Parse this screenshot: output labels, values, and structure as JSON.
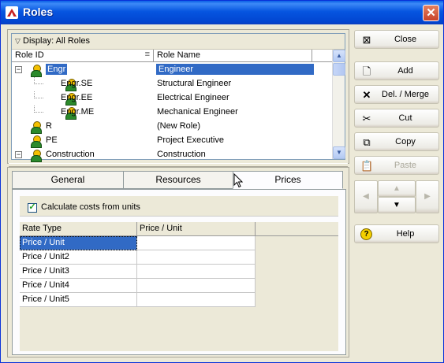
{
  "window": {
    "title": "Roles",
    "close_glyph": "✕"
  },
  "roles_grid": {
    "display_label": "Display: All Roles",
    "columns": [
      "Role ID",
      "Role Name"
    ],
    "rows": [
      {
        "id": "Engr",
        "name": "Engineer",
        "level": 0,
        "expander": "−",
        "selected": true
      },
      {
        "id": "Engr.SE",
        "name": "Structural Engineer",
        "level": 1
      },
      {
        "id": "Engr.EE",
        "name": "Electrical Engineer",
        "level": 1
      },
      {
        "id": "Engr.ME",
        "name": "Mechanical Engineer",
        "level": 1
      },
      {
        "id": "R",
        "name": "(New Role)",
        "level": 0
      },
      {
        "id": "PE",
        "name": "Project Executive",
        "level": 0
      },
      {
        "id": "Construction",
        "name": "Construction",
        "level": 0,
        "expander": "−"
      }
    ]
  },
  "tabs": {
    "general": "General",
    "resources": "Resources",
    "prices": "Prices",
    "active": "Prices"
  },
  "prices": {
    "calc_label": "Calculate costs from units",
    "calc_checked": true,
    "columns": [
      "Rate Type",
      "Price / Unit"
    ],
    "rows": [
      {
        "rate_type": "Price / Unit",
        "price": ""
      },
      {
        "rate_type": "Price / Unit2",
        "price": ""
      },
      {
        "rate_type": "Price / Unit3",
        "price": ""
      },
      {
        "rate_type": "Price / Unit4",
        "price": ""
      },
      {
        "rate_type": "Price / Unit5",
        "price": ""
      }
    ]
  },
  "buttons": {
    "close": "Close",
    "add": "Add",
    "del_merge": "Del. / Merge",
    "cut": "Cut",
    "copy": "Copy",
    "paste": "Paste",
    "help": "Help"
  },
  "colors": {
    "selection": "#316ac5",
    "titlebar": "#0a5fe6",
    "window_bg": "#ece9d8"
  }
}
